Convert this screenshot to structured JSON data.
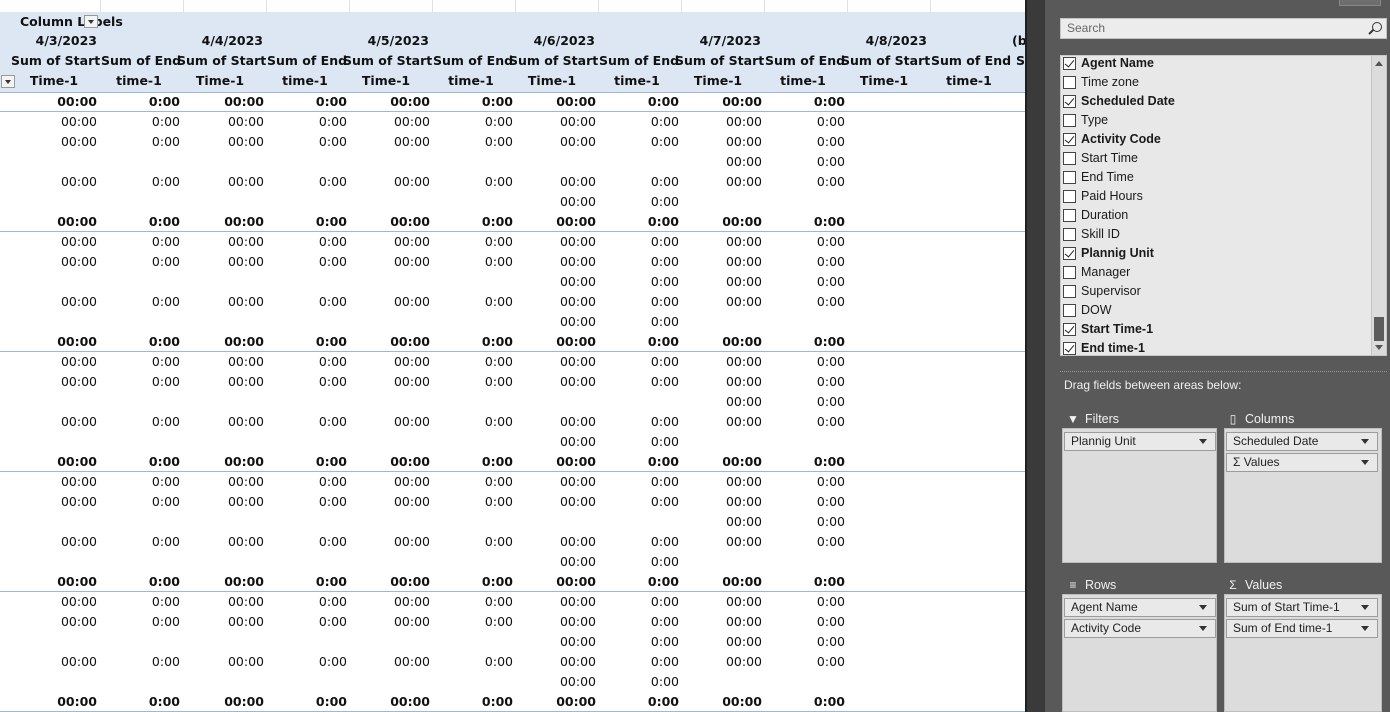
{
  "pivot": {
    "column_labels": "Column Labels",
    "dates": [
      "4/3/2023",
      "4/4/2023",
      "4/5/2023",
      "4/6/2023",
      "4/7/2023",
      "4/8/2023",
      "(b"
    ],
    "measure_start": [
      "Sum of Start",
      "Time-1"
    ],
    "measure_end": [
      "Sum of End",
      "time-1"
    ],
    "truncated_col": [
      "S",
      ""
    ],
    "rows": [
      {
        "sub": true,
        "v": [
          "00:00",
          "0:00",
          "00:00",
          "0:00",
          "00:00",
          "0:00",
          "00:00",
          "0:00",
          "00:00",
          "0:00"
        ]
      },
      {
        "sub": false,
        "v": [
          "00:00",
          "0:00",
          "00:00",
          "0:00",
          "00:00",
          "0:00",
          "00:00",
          "0:00",
          "00:00",
          "0:00"
        ]
      },
      {
        "sub": false,
        "v": [
          "00:00",
          "0:00",
          "00:00",
          "0:00",
          "00:00",
          "0:00",
          "00:00",
          "0:00",
          "00:00",
          "0:00"
        ]
      },
      {
        "sub": false,
        "v": [
          "",
          "",
          "",
          "",
          "",
          "",
          "",
          "",
          "00:00",
          "0:00"
        ]
      },
      {
        "sub": false,
        "v": [
          "00:00",
          "0:00",
          "00:00",
          "0:00",
          "00:00",
          "0:00",
          "00:00",
          "0:00",
          "00:00",
          "0:00"
        ]
      },
      {
        "sub": false,
        "v": [
          "",
          "",
          "",
          "",
          "",
          "",
          "00:00",
          "0:00",
          "",
          ""
        ]
      },
      {
        "sub": true,
        "v": [
          "00:00",
          "0:00",
          "00:00",
          "0:00",
          "00:00",
          "0:00",
          "00:00",
          "0:00",
          "00:00",
          "0:00"
        ]
      },
      {
        "sub": false,
        "v": [
          "00:00",
          "0:00",
          "00:00",
          "0:00",
          "00:00",
          "0:00",
          "00:00",
          "0:00",
          "00:00",
          "0:00"
        ]
      },
      {
        "sub": false,
        "v": [
          "00:00",
          "0:00",
          "00:00",
          "0:00",
          "00:00",
          "0:00",
          "00:00",
          "0:00",
          "00:00",
          "0:00"
        ]
      },
      {
        "sub": false,
        "v": [
          "",
          "",
          "",
          "",
          "",
          "",
          "00:00",
          "0:00",
          "00:00",
          "0:00"
        ]
      },
      {
        "sub": false,
        "v": [
          "00:00",
          "0:00",
          "00:00",
          "0:00",
          "00:00",
          "0:00",
          "00:00",
          "0:00",
          "00:00",
          "0:00"
        ]
      },
      {
        "sub": false,
        "v": [
          "",
          "",
          "",
          "",
          "",
          "",
          "00:00",
          "0:00",
          "",
          ""
        ]
      },
      {
        "sub": true,
        "v": [
          "00:00",
          "0:00",
          "00:00",
          "0:00",
          "00:00",
          "0:00",
          "00:00",
          "0:00",
          "00:00",
          "0:00"
        ]
      },
      {
        "sub": false,
        "v": [
          "00:00",
          "0:00",
          "00:00",
          "0:00",
          "00:00",
          "0:00",
          "00:00",
          "0:00",
          "00:00",
          "0:00"
        ]
      },
      {
        "sub": false,
        "v": [
          "00:00",
          "0:00",
          "00:00",
          "0:00",
          "00:00",
          "0:00",
          "00:00",
          "0:00",
          "00:00",
          "0:00"
        ]
      },
      {
        "sub": false,
        "v": [
          "",
          "",
          "",
          "",
          "",
          "",
          "",
          "",
          "00:00",
          "0:00"
        ]
      },
      {
        "sub": false,
        "v": [
          "00:00",
          "0:00",
          "00:00",
          "0:00",
          "00:00",
          "0:00",
          "00:00",
          "0:00",
          "00:00",
          "0:00"
        ]
      },
      {
        "sub": false,
        "v": [
          "",
          "",
          "",
          "",
          "",
          "",
          "00:00",
          "0:00",
          "",
          ""
        ]
      },
      {
        "sub": true,
        "v": [
          "00:00",
          "0:00",
          "00:00",
          "0:00",
          "00:00",
          "0:00",
          "00:00",
          "0:00",
          "00:00",
          "0:00"
        ]
      },
      {
        "sub": false,
        "v": [
          "00:00",
          "0:00",
          "00:00",
          "0:00",
          "00:00",
          "0:00",
          "00:00",
          "0:00",
          "00:00",
          "0:00"
        ]
      },
      {
        "sub": false,
        "v": [
          "00:00",
          "0:00",
          "00:00",
          "0:00",
          "00:00",
          "0:00",
          "00:00",
          "0:00",
          "00:00",
          "0:00"
        ]
      },
      {
        "sub": false,
        "v": [
          "",
          "",
          "",
          "",
          "",
          "",
          "",
          "",
          "00:00",
          "0:00"
        ]
      },
      {
        "sub": false,
        "v": [
          "00:00",
          "0:00",
          "00:00",
          "0:00",
          "00:00",
          "0:00",
          "00:00",
          "0:00",
          "00:00",
          "0:00"
        ]
      },
      {
        "sub": false,
        "v": [
          "",
          "",
          "",
          "",
          "",
          "",
          "00:00",
          "0:00",
          "",
          ""
        ]
      },
      {
        "sub": true,
        "v": [
          "00:00",
          "0:00",
          "00:00",
          "0:00",
          "00:00",
          "0:00",
          "00:00",
          "0:00",
          "00:00",
          "0:00"
        ]
      },
      {
        "sub": false,
        "v": [
          "00:00",
          "0:00",
          "00:00",
          "0:00",
          "00:00",
          "0:00",
          "00:00",
          "0:00",
          "00:00",
          "0:00"
        ]
      },
      {
        "sub": false,
        "v": [
          "00:00",
          "0:00",
          "00:00",
          "0:00",
          "00:00",
          "0:00",
          "00:00",
          "0:00",
          "00:00",
          "0:00"
        ]
      },
      {
        "sub": false,
        "v": [
          "",
          "",
          "",
          "",
          "",
          "",
          "00:00",
          "0:00",
          "00:00",
          "0:00"
        ]
      },
      {
        "sub": false,
        "v": [
          "00:00",
          "0:00",
          "00:00",
          "0:00",
          "00:00",
          "0:00",
          "00:00",
          "0:00",
          "00:00",
          "0:00"
        ]
      },
      {
        "sub": false,
        "v": [
          "",
          "",
          "",
          "",
          "",
          "",
          "00:00",
          "0:00",
          "",
          ""
        ]
      },
      {
        "sub": true,
        "v": [
          "00:00",
          "0:00",
          "00:00",
          "0:00",
          "00:00",
          "0:00",
          "00:00",
          "0:00",
          "00:00",
          "0:00"
        ]
      }
    ]
  },
  "field_list": {
    "search_placeholder": "Search",
    "fields": [
      {
        "label": "Agent Name",
        "checked": true
      },
      {
        "label": "Time zone",
        "checked": false
      },
      {
        "label": "Scheduled Date",
        "checked": true
      },
      {
        "label": "Type",
        "checked": false
      },
      {
        "label": "Activity Code",
        "checked": true
      },
      {
        "label": "Start Time",
        "checked": false
      },
      {
        "label": "End Time",
        "checked": false
      },
      {
        "label": "Paid Hours",
        "checked": false
      },
      {
        "label": "Duration",
        "checked": false
      },
      {
        "label": "Skill ID",
        "checked": false
      },
      {
        "label": "Plannig Unit",
        "checked": true
      },
      {
        "label": "Manager",
        "checked": false
      },
      {
        "label": "Supervisor",
        "checked": false
      },
      {
        "label": "DOW",
        "checked": false
      },
      {
        "label": "Start Time-1",
        "checked": true
      },
      {
        "label": "End time-1",
        "checked": true
      }
    ],
    "drag_note": "Drag fields between areas below:",
    "areas": {
      "filters": {
        "title": "Filters",
        "icon": "filter-icon",
        "items": [
          "Plannig Unit"
        ]
      },
      "columns": {
        "title": "Columns",
        "icon": "columns-icon",
        "items": [
          "Scheduled Date",
          "Σ Values"
        ]
      },
      "rows": {
        "title": "Rows",
        "icon": "rows-icon",
        "items": [
          "Agent Name",
          "Activity Code"
        ]
      },
      "values": {
        "title": "Values",
        "icon": "sigma-icon",
        "items": [
          "Sum of Start Time-1",
          "Sum of End time-1"
        ]
      }
    }
  },
  "colors": {
    "header_bg": "#dde7f4",
    "pane_bg": "#595959",
    "field_box_bg": "#e8e8e8"
  }
}
